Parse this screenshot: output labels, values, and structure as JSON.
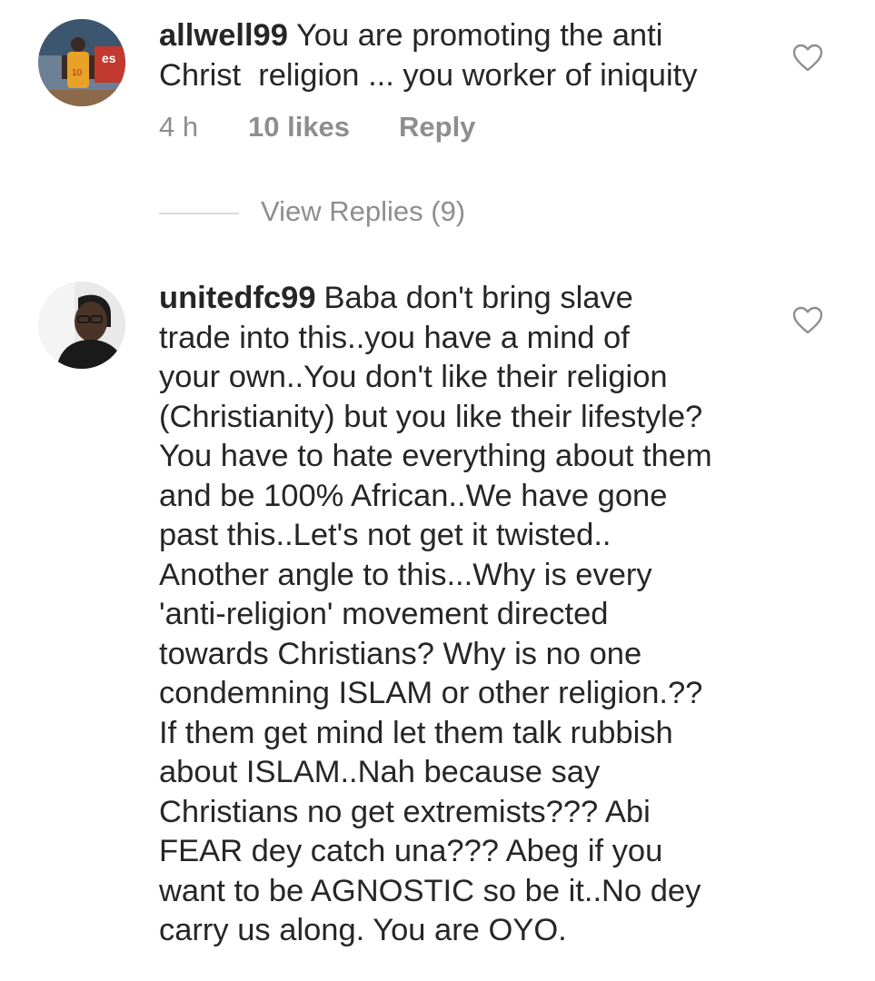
{
  "comments": [
    {
      "username": "allwell99",
      "text_lines": [
        "You are promoting the anti",
        "Christ  religion ... you worker of iniquity"
      ],
      "time": "4 h",
      "likes": "10 likes",
      "reply": "Reply",
      "avatar_icon": "profile-photo-basketball-player",
      "like_icon": "heart-outline-icon"
    },
    {
      "username": "unitedfc99",
      "text_lines": [
        "Baba don't bring slave",
        "trade into this..you have a mind of",
        "your own..You don't like their religion",
        "(Christianity) but you like their lifestyle?",
        "You have to hate everything about them",
        "and be 100% African..We have gone",
        "past this..Let's not get it twisted..",
        "Another angle to this...Why is every",
        "'anti-religion' movement directed",
        "towards Christians? Why is no one",
        "condemning ISLAM or other religion.??",
        "If them get mind let them talk rubbish",
        "about ISLAM..Nah because say",
        "Christians no get extremists??? Abi",
        "FEAR dey catch una??? Abeg if you",
        "want to be AGNOSTIC so be it..No dey",
        "carry us along. You are OYO."
      ],
      "avatar_icon": "profile-photo-man-with-glasses",
      "like_icon": "heart-outline-icon"
    }
  ],
  "view_replies": "View Replies (9)",
  "colors": {
    "text": "#262626",
    "secondary": "#8e8e8e",
    "divider": "#dbdbdb"
  }
}
